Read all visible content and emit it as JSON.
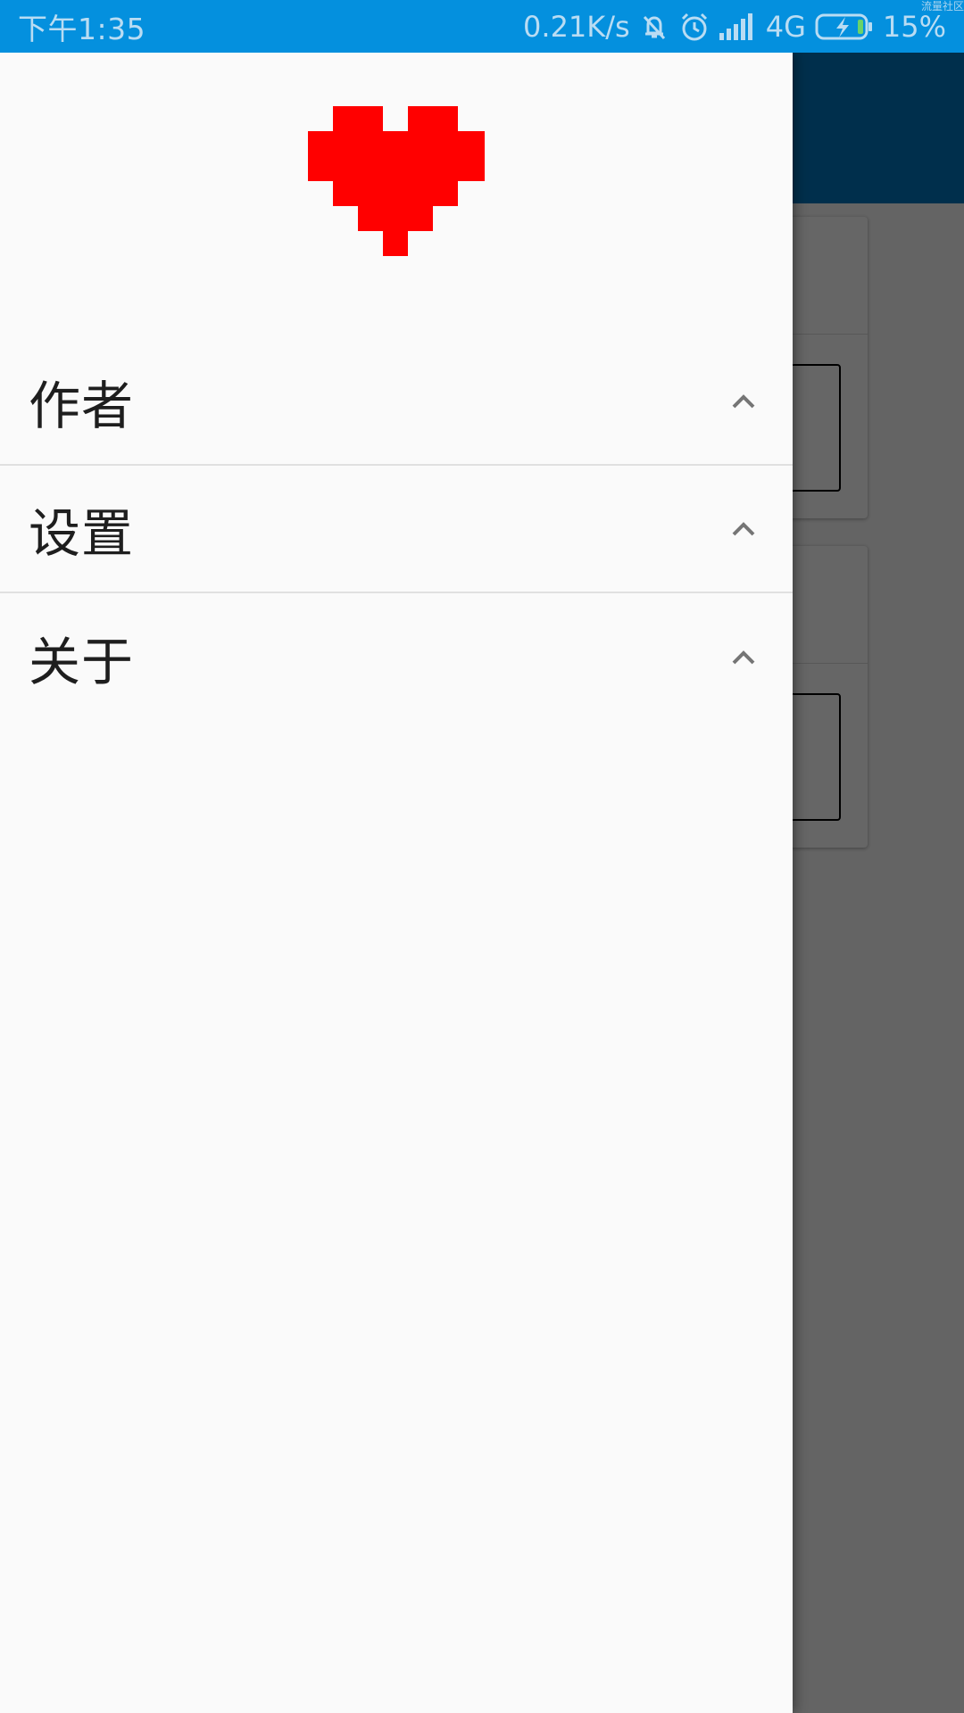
{
  "status_bar": {
    "time": "下午1:35",
    "net_speed": "0.21K/s",
    "network_type": "4G",
    "battery_percent": "15%",
    "watermark": "流量社区",
    "icons": [
      "mute-bell-icon",
      "alarm-icon",
      "signal-icon",
      "battery-charging-icon"
    ],
    "bg_color": "#0490de"
  },
  "drawer": {
    "header_icon": "pixel-heart-icon",
    "header_icon_color": "#ff0000",
    "items": [
      {
        "label": "作者",
        "icon": "chevron-up-icon"
      },
      {
        "label": "设置",
        "icon": "chevron-up-icon"
      },
      {
        "label": "关于",
        "icon": "chevron-up-icon"
      }
    ]
  },
  "background_app": {
    "toolbar_color": "#0277bd"
  }
}
